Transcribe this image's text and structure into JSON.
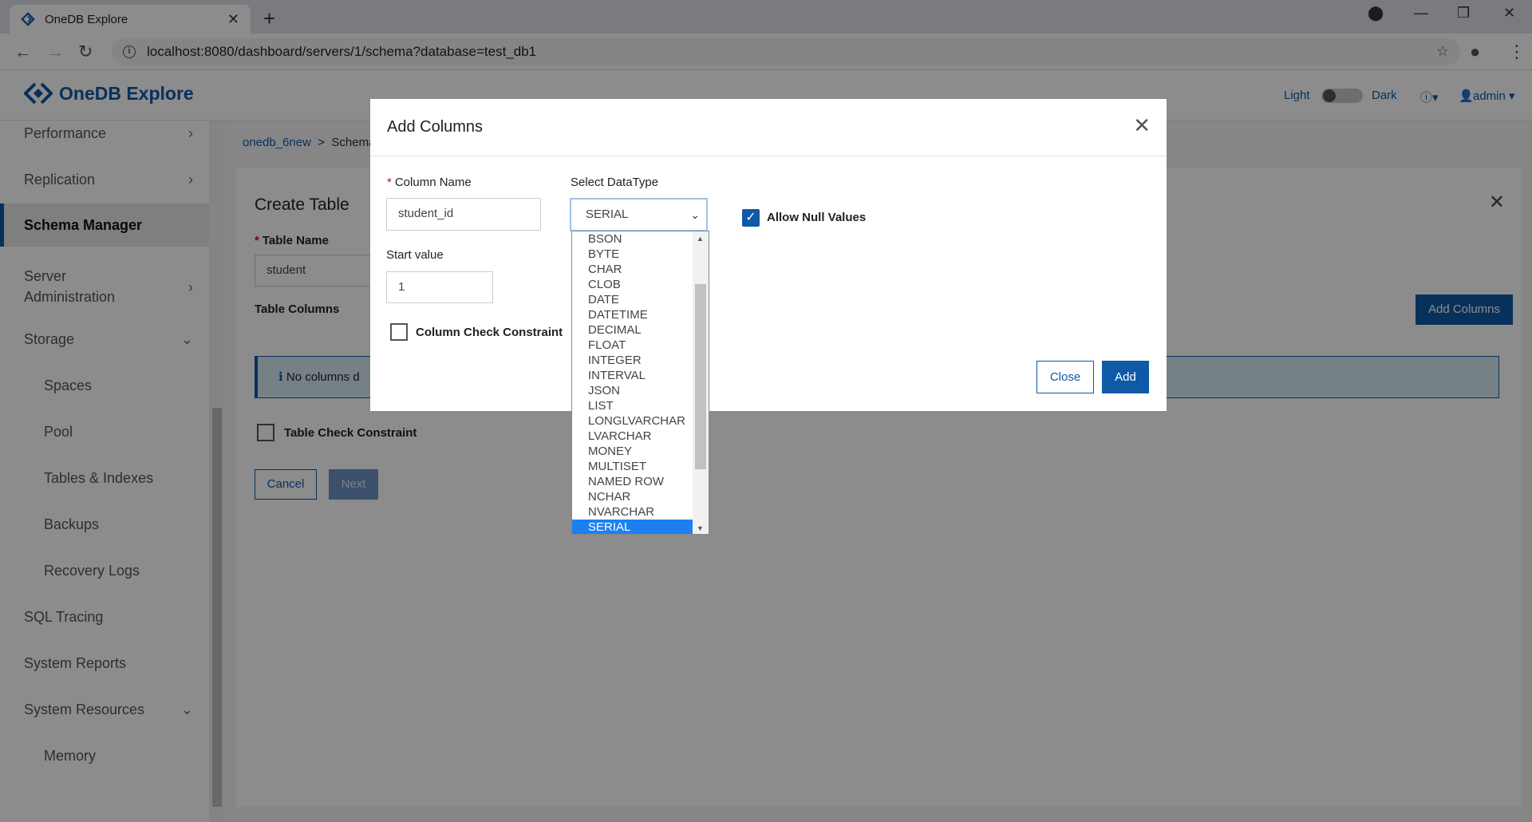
{
  "browser": {
    "tab_title": "OneDB Explore",
    "url": "localhost:8080/dashboard/servers/1/schema?database=test_db1"
  },
  "app": {
    "brand": "OneDB Explore",
    "theme_light": "Light",
    "theme_dark": "Dark",
    "user": "admin"
  },
  "sidebar": {
    "items": [
      {
        "label": "Performance"
      },
      {
        "label": "Replication"
      },
      {
        "label": "Schema Manager"
      },
      {
        "label": "Server Administration"
      },
      {
        "label": "Storage"
      },
      {
        "label": "Spaces"
      },
      {
        "label": "Pool"
      },
      {
        "label": "Tables & Indexes"
      },
      {
        "label": "Backups"
      },
      {
        "label": "Recovery Logs"
      },
      {
        "label": "SQL Tracing"
      },
      {
        "label": "System Reports"
      },
      {
        "label": "System Resources"
      },
      {
        "label": "Memory"
      }
    ]
  },
  "breadcrumb": {
    "db": "onedb_6new",
    "sep": ">",
    "page": "Schema"
  },
  "create_table": {
    "title": "Create Table",
    "table_name_label": "Table Name",
    "table_name_value": "student",
    "table_columns_label": "Table Columns",
    "add_columns_button": "Add Columns",
    "no_columns_text": "No columns d",
    "table_check_constraint": "Table Check Constraint",
    "cancel_button": "Cancel",
    "next_button": "Next"
  },
  "modal": {
    "title": "Add Columns",
    "column_name_label": "Column Name",
    "column_name_value": "student_id",
    "datatype_label": "Select DataType",
    "datatype_value": "SERIAL",
    "allow_null_label": "Allow Null Values",
    "start_value_label": "Start value",
    "start_value": "1",
    "column_check_constraint": "Column Check Constraint",
    "close_button": "Close",
    "add_button": "Add",
    "datatype_options": [
      "BSON",
      "BYTE",
      "CHAR",
      "CLOB",
      "DATE",
      "DATETIME",
      "DECIMAL",
      "FLOAT",
      "INTEGER",
      "INTERVAL",
      "JSON",
      "LIST",
      "LONGLVARCHAR",
      "LVARCHAR",
      "MONEY",
      "MULTISET",
      "NAMED ROW",
      "NCHAR",
      "NVARCHAR",
      "SERIAL"
    ]
  },
  "colors": {
    "brand": "#0e5aa7",
    "selected_option": "#1e7ff0"
  }
}
